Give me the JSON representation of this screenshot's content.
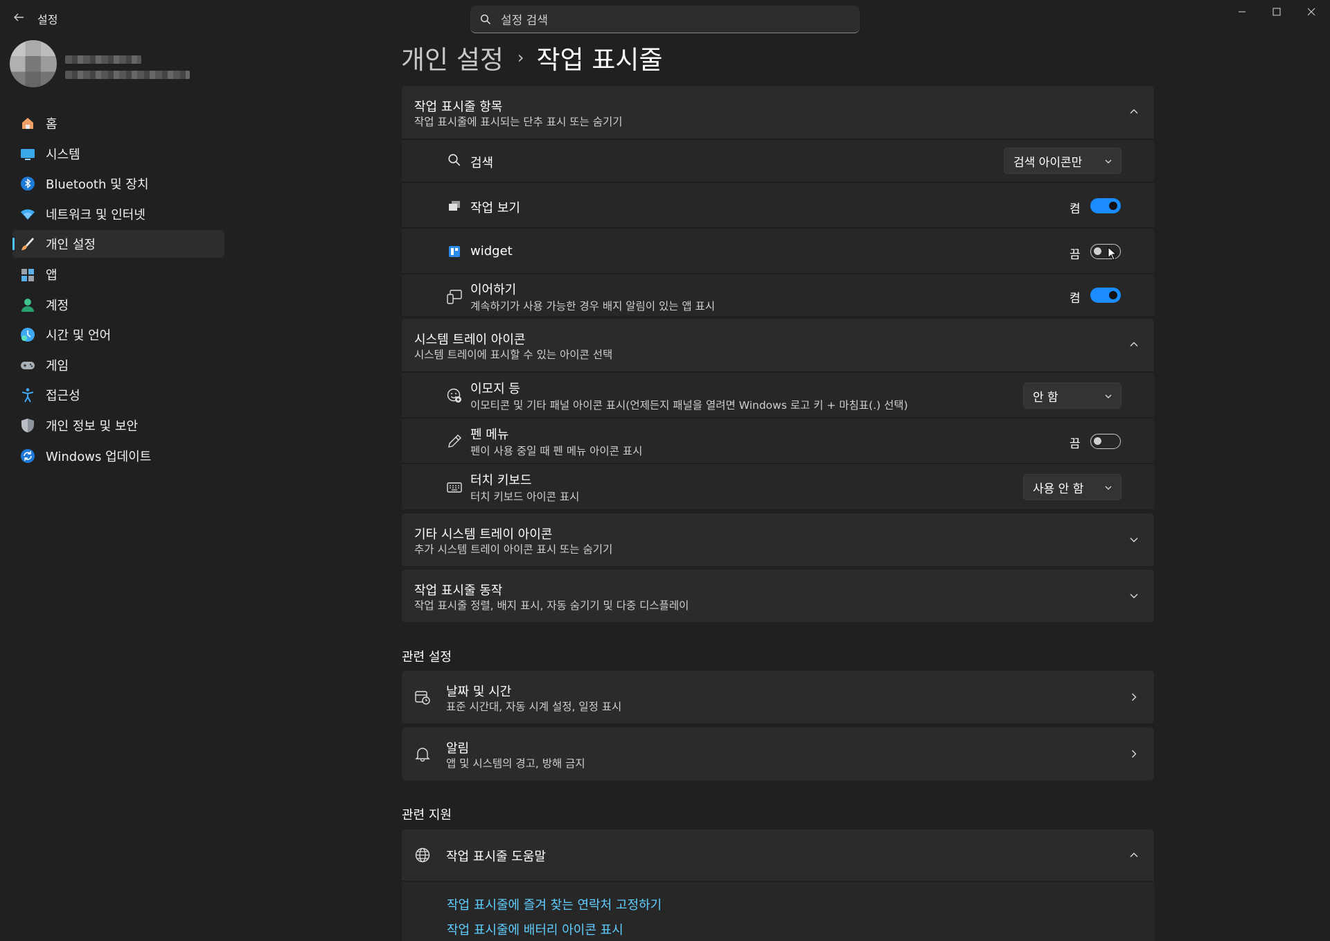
{
  "window": {
    "app_title": "설정",
    "search_placeholder": "설정 검색"
  },
  "breadcrumb": {
    "parent": "개인 설정",
    "separator": "›",
    "current": "작업 표시줄"
  },
  "sidebar": {
    "items": [
      {
        "label": "홈",
        "icon": "home-icon"
      },
      {
        "label": "시스템",
        "icon": "system-icon"
      },
      {
        "label": "Bluetooth 및 장치",
        "icon": "bluetooth-icon"
      },
      {
        "label": "네트워크 및 인터넷",
        "icon": "wifi-icon"
      },
      {
        "label": "개인 설정",
        "icon": "brush-icon",
        "active": true
      },
      {
        "label": "앱",
        "icon": "apps-icon"
      },
      {
        "label": "계정",
        "icon": "account-icon"
      },
      {
        "label": "시간 및 언어",
        "icon": "time-language-icon"
      },
      {
        "label": "게임",
        "icon": "gaming-icon"
      },
      {
        "label": "접근성",
        "icon": "accessibility-icon"
      },
      {
        "label": "개인 정보 및 보안",
        "icon": "shield-icon"
      },
      {
        "label": "Windows 업데이트",
        "icon": "update-icon"
      }
    ]
  },
  "taskbar_items": {
    "title": "작업 표시줄 항목",
    "subtitle": "작업 표시줄에 표시되는 단추 표시 또는 숨기기",
    "search": {
      "label": "검색",
      "value": "검색 아이콘만"
    },
    "task_view": {
      "label": "작업 보기",
      "state": "켬"
    },
    "widget": {
      "label": "widget",
      "state": "끔"
    },
    "continue": {
      "label": "이어하기",
      "desc": "계속하기가 사용 가능한 경우 배지 알림이 있는 앱 표시",
      "state": "켬"
    }
  },
  "system_tray": {
    "title": "시스템 트레이 아이콘",
    "subtitle": "시스템 트레이에 표시할 수 있는 아이콘 선택",
    "emoji": {
      "label": "이모지 등",
      "desc": "이모티콘 및 기타 패널 아이콘 표시(언제든지 패널을 열려면 Windows 로고 키 + 마침표(.) 선택)",
      "value": "안 함"
    },
    "pen": {
      "label": "펜 메뉴",
      "desc": "펜이 사용 중일 때 펜 메뉴 아이콘 표시",
      "state": "끔"
    },
    "touch_keyboard": {
      "label": "터치 키보드",
      "desc": "터치 키보드 아이콘 표시",
      "value": "사용 안 함"
    }
  },
  "other_tray": {
    "title": "기타 시스템 트레이 아이콘",
    "subtitle": "추가 시스템 트레이 아이콘 표시 또는 숨기기"
  },
  "behaviors": {
    "title": "작업 표시줄 동작",
    "subtitle": "작업 표시줄 정렬, 배지 표시, 자동 숨기기 및 다중 디스플레이"
  },
  "related_settings": {
    "heading": "관련 설정",
    "date_time": {
      "title": "날짜 및 시간",
      "subtitle": "표준 시간대, 자동 시계 설정, 일정 표시"
    },
    "notifications": {
      "title": "알림",
      "subtitle": "앱 및 시스템의 경고, 방해 금지"
    }
  },
  "related_support": {
    "heading": "관련 지원",
    "help": {
      "title": "작업 표시줄 도움말"
    },
    "links": [
      "작업 표시줄에 즐겨 찾는 연락처 고정하기",
      "작업 표시줄에 배터리 아이콘 표시"
    ]
  },
  "colors": {
    "accent": "#60cdff",
    "toggle_on": "#1a8cff",
    "background": "#202020",
    "card": "#2b2b2b"
  }
}
